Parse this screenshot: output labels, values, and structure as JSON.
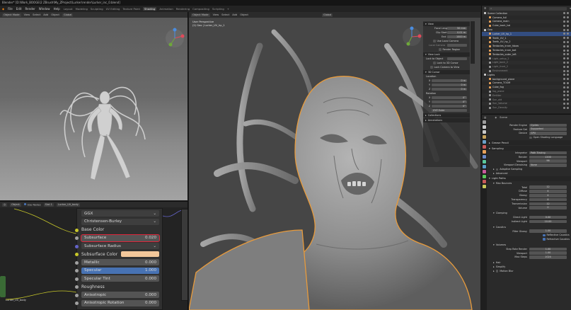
{
  "title_bar": "Blender* [D:\\Work_BOOGE\\2 ZBrush\\My_ZProject\\Lurker\\render\\Lurker_inc_0.blend]",
  "menu": [
    "File",
    "Edit",
    "Render",
    "Window",
    "Help"
  ],
  "workspace_tabs": [
    "Layout",
    "Modeling",
    "Sculpting",
    "UV Editing",
    "Texture Paint",
    "Shading",
    "Animation",
    "Rendering",
    "Compositing",
    "Scripting"
  ],
  "active_workspace": "Shading",
  "scene_label": "Scene",
  "view_layer_label": "View Layer",
  "left_viewport": {
    "mode": "Object Mode",
    "menus": [
      "View",
      "Select",
      "Add",
      "Object"
    ],
    "orientation": "Global"
  },
  "node_editor": {
    "object_dropdown": "Object",
    "use_nodes": "Use Nodes",
    "slot": "Slot 1",
    "material": "Lurker_UV_body",
    "node_label": "Lurker_UV_body"
  },
  "shader_panel": {
    "distribution": "GGX",
    "subsurface_method": "Christensen-Burley",
    "base_color_label": "Base Color",
    "subsurface_label": "Subsurface",
    "subsurface_value": "0.020",
    "subsurface_radius_label": "Subsurface Radius",
    "subsurface_color_label": "Subsurface Color",
    "metallic_label": "Metallic",
    "metallic_value": "0.000",
    "specular_label": "Specular",
    "specular_value": "1.000",
    "specular_tint_label": "Specular Tint",
    "specular_tint_value": "0.000",
    "roughness_label": "Roughness",
    "anisotropic_label": "Anisotropic",
    "anisotropic_value": "0.000",
    "anisotropic_rotation_label": "Anisotropic Rotation",
    "anisotropic_rotation_value": "0.000",
    "subsurface_color_hex": "#f2c79a",
    "specular_fill": 1.0
  },
  "main_viewport": {
    "mode": "Object Mode",
    "menus": [
      "View",
      "Select",
      "Add",
      "Object"
    ],
    "orientation": "Global",
    "info_line1": "User Perspective",
    "info_line2": "(2) Geo | Lurker_UV_hp_1"
  },
  "n_panel": {
    "view_header": "View",
    "rows": [
      {
        "label": "Focal Length",
        "value": "50 mm"
      },
      {
        "label": "Clip Start",
        "value": "0.01 m"
      },
      {
        "label": "End",
        "value": "1000 m"
      }
    ],
    "use_local_camera": "Use Local Camera",
    "local_camera": "Local Camera",
    "render_region": "Render Region",
    "view_lock_header": "View Lock",
    "lock_to_object": "Lock to Object",
    "lock_3d_cursor": "Lock to 3D Cursor",
    "lock_camera_view": "Lock Camera to View",
    "cursor_header": "3D Cursor",
    "location_label": "Location",
    "location": [
      {
        "axis": "X",
        "value": "0 m"
      },
      {
        "axis": "Y",
        "value": "0 m"
      },
      {
        "axis": "Z",
        "value": "0 m"
      }
    ],
    "rotation_label": "Rotation",
    "rotation": [
      {
        "axis": "X",
        "value": "0°"
      },
      {
        "axis": "Y",
        "value": "0°"
      },
      {
        "axis": "Z",
        "value": "0°"
      }
    ],
    "rotation_mode": "XYZ Euler",
    "collections_header": "Collections",
    "annotations_header": "Annotations"
  },
  "outliner": {
    "items": [
      {
        "name": "Scene Collection",
        "color": "#cfcfcf"
      },
      {
        "name": "Camera_full",
        "color": "#e8a25a"
      },
      {
        "name": "Camera_main",
        "color": "#e8a25a"
      },
      {
        "name": "Cube_back_hai",
        "color": "#e8a25a"
      },
      {
        "name": "Geo",
        "color": "#cfcfcf"
      },
      {
        "name": "Lurker_UV_hp_1",
        "color": "#e8a25a",
        "selected": true
      },
      {
        "name": "Teeth_UV_1",
        "color": "#e8a25a"
      },
      {
        "name": "Teeth_UV_hp_2",
        "color": "#e8a25a"
      },
      {
        "name": "Tentacles_inner_hbow",
        "color": "#e8a25a"
      },
      {
        "name": "Tentacles_inner_bat",
        "color": "#e8a25a"
      },
      {
        "name": "Tentacles_outer_left",
        "color": "#e8a25a"
      },
      {
        "name": "Light_setup_2",
        "color": "#9a9a9a"
      },
      {
        "name": "Light_back_2",
        "color": "#9a9a9a"
      },
      {
        "name": "Light_front_2",
        "color": "#9a9a9a"
      },
      {
        "name": "Environment",
        "color": "#9a9a9a"
      },
      {
        "name": "Lights",
        "color": "#cfcfcf"
      },
      {
        "name": "background_plane",
        "color": "#e8a25a"
      },
      {
        "name": "Camera_TOOM",
        "color": "#e8a25a"
      },
      {
        "name": "Cube_fog",
        "color": "#e8a25a"
      },
      {
        "name": "fog_plane",
        "color": "#9a9a9a"
      },
      {
        "name": "Emitter",
        "color": "#9a9a9a"
      },
      {
        "name": "Sun_old",
        "color": "#9a9a9a"
      },
      {
        "name": "Sun_Volume",
        "color": "#9a9a9a"
      },
      {
        "name": "Sun_Density",
        "color": "#9a9a9a"
      }
    ]
  },
  "properties": {
    "scene_name": "Scene",
    "render_engine_label": "Render Engine",
    "render_engine": "Cycles",
    "feature_set_label": "Feature Set",
    "feature_set": "Supported",
    "device_label": "Device",
    "device": "GPU",
    "open_shading_language": "Open Shading Language",
    "grease_pencil": "Grease Pencil",
    "sampling_header": "Sampling",
    "integrator_label": "Integrator",
    "integrator": "Path Tracing",
    "render_label": "Render",
    "render_samples": "1200",
    "viewport_label": "Viewport",
    "viewport_samples": "96",
    "viewport_denoising_label": "Viewport Denoising",
    "viewport_denoising": "None",
    "adaptive_sampling": "Adaptive Sampling",
    "advanced": "Advanced",
    "light_paths_header": "Light Paths",
    "max_bounces": "Max Bounces",
    "bounces": [
      {
        "label": "Total",
        "value": "12"
      },
      {
        "label": "Diffuse",
        "value": "4"
      },
      {
        "label": "Glossy",
        "value": "4"
      },
      {
        "label": "Transparency",
        "value": "8"
      },
      {
        "label": "Transmission",
        "value": "12"
      },
      {
        "label": "Volume",
        "value": "0"
      }
    ],
    "clamping": "Clamping",
    "direct_light_label": "Direct Light",
    "direct_light": "0.00",
    "indirect_light_label": "Indirect Light",
    "indirect_light": "10.00",
    "caustics": "Caustics",
    "filter_glossy_label": "Filter Glossy",
    "filter_glossy": "1.00",
    "reflective_caustics": "Reflective Caustics",
    "refractive_caustics": "Refractive Caustics",
    "volumes": "Volumes",
    "step_rate_render_label": "Step Rate Render",
    "step_rate_render": "1.00",
    "step_viewport_label": "Viewport",
    "step_viewport": "1.00",
    "max_steps_label": "Max Steps",
    "max_steps": "1024",
    "hair": "Hair",
    "simplify": "Simplify",
    "motion_blur": "Motion Blur"
  }
}
